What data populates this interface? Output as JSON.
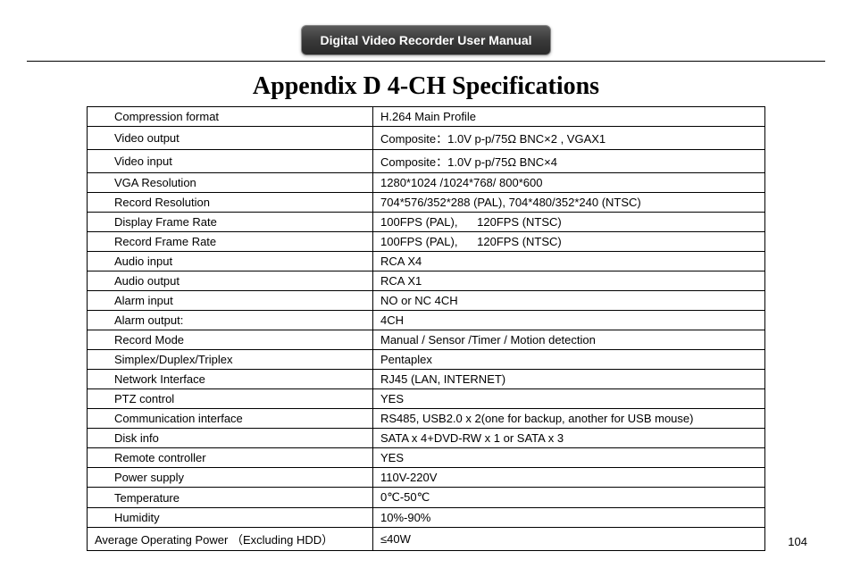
{
  "header": {
    "badge": "Digital Video Recorder User Manual"
  },
  "title": "Appendix D    4-CH Specifications",
  "page_number": "104",
  "specs": [
    {
      "label": "Compression format",
      "value": "H.264 Main Profile"
    },
    {
      "label": "Video output",
      "value": "Composite：1.0V p-p/75Ω BNC×2 , VGAX1"
    },
    {
      "label": "Video input",
      "value": "Composite：1.0V p-p/75Ω BNC×4"
    },
    {
      "label": "VGA Resolution",
      "value": "1280*1024 /1024*768/ 800*600"
    },
    {
      "label": "Record Resolution",
      "value": "704*576/352*288 (PAL), 704*480/352*240 (NTSC)"
    },
    {
      "label": "Display Frame Rate",
      "value": "100FPS (PAL),      120FPS (NTSC)"
    },
    {
      "label": "Record Frame Rate",
      "value": "100FPS (PAL),      120FPS (NTSC)"
    },
    {
      "label": "Audio input",
      "value": "RCA X4"
    },
    {
      "label": "Audio output",
      "value": "RCA X1"
    },
    {
      "label": "Alarm input",
      "value": "NO or NC 4CH"
    },
    {
      "label": "Alarm output:",
      "value": "4CH"
    },
    {
      "label": "Record Mode",
      "value": "Manual / Sensor /Timer / Motion detection"
    },
    {
      "label": "Simplex/Duplex/Triplex",
      "value": "Pentaplex"
    },
    {
      "label": "Network Interface",
      "value": "RJ45 (LAN, INTERNET)"
    },
    {
      "label": "PTZ control",
      "value": "YES"
    },
    {
      "label": "Communication interface",
      "value": "RS485, USB2.0 x 2(one for backup, another for USB mouse)"
    },
    {
      "label": "Disk info",
      "value": "SATA x 4+DVD-RW x 1 or SATA x 3"
    },
    {
      "label": "Remote controller",
      "value": "YES"
    },
    {
      "label": "Power supply",
      "value": "110V-220V"
    },
    {
      "label": "Temperature",
      "value": "0℃-50℃"
    },
    {
      "label": "Humidity",
      "value": "10%-90%"
    },
    {
      "label": "Average Operating Power  （Excluding HDD）",
      "value": "≤40W",
      "indent": false
    }
  ]
}
